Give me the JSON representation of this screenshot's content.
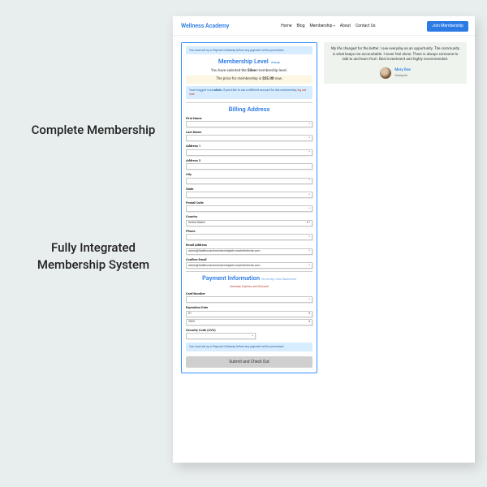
{
  "captions": {
    "c1": "Complete Membership",
    "c2": "Fully Integrated Membership System"
  },
  "nav": {
    "brand": "Wellness Academy",
    "items": [
      "Home",
      "Blog",
      "Membership",
      "About",
      "Contact Us"
    ],
    "join": "Join Membership"
  },
  "alerts": {
    "top": "You must set up a Payment Gateway before any payment will be processed.",
    "login_prefix": "You're logged in as ",
    "login_user": "admin",
    "login_mid": ". If you'd like to use a different account for this membership, ",
    "login_link": "log out now.",
    "bottom": "You must set up a Payment Gateway before any payment will be processed."
  },
  "membership": {
    "title": "Membership Level",
    "change": "change",
    "selected_pre": "You have selected the ",
    "selected_level": "Silver",
    "selected_post": " membership level.",
    "price_pre": "The price for membership is ",
    "price_val": "$25.00",
    "price_post": " now."
  },
  "billing": {
    "title": "Billing Address",
    "fields": {
      "first": "First Name",
      "last": "Last Name",
      "addr1": "Address 1",
      "addr2": "Address 2",
      "city": "City",
      "state": "State",
      "postal": "Postal Code",
      "country": "Country",
      "country_val": "United States",
      "phone": "Phone",
      "email": "Email Address",
      "email_val": "admin@healthcoachmembershipsite.marketertecha.com",
      "cemail": "Confirm Email",
      "cemail_val": "admin@healthcoachmembershipsite.marketertecha.com"
    }
  },
  "payment": {
    "title": "Payment Information",
    "sub": "We Accept Visa, Mastercard",
    "accepted": "American Express, and Discover",
    "card": "Card Number",
    "exp": "Expiration Date",
    "exp_month": "01",
    "exp_year": "2023",
    "cvc": "Security Code (CVC)"
  },
  "submit": "Submit and Check Out",
  "testimonial": {
    "text": "My life changed for the better. I see everyday as an opportunity. The community is what keeps me accountable. I never feel alone. There is always someone to talk to and learn from. Best investment and highly recommended.",
    "name": "Mary Doe",
    "role": "Designer"
  }
}
